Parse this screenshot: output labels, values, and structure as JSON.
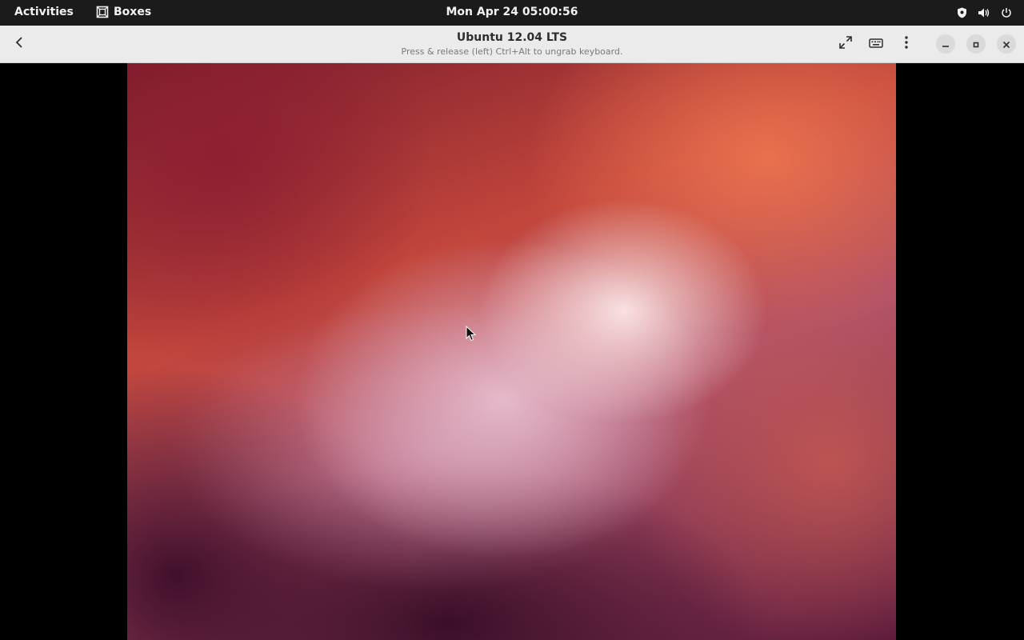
{
  "topbar": {
    "activities_label": "Activities",
    "app_name": "Boxes",
    "clock": "Mon Apr 24  05:00:56",
    "system_icons": [
      "shield-icon",
      "volume-icon",
      "power-icon"
    ]
  },
  "headerbar": {
    "title": "Ubuntu 12.04 LTS",
    "subtitle": "Press & release (left) Ctrl+Alt to ungrab keyboard.",
    "buttons": [
      "back-icon",
      "fullscreen-icon",
      "keyboard-icon",
      "menu-icon",
      "minimize-icon",
      "maximize-icon",
      "close-icon"
    ]
  },
  "colors": {
    "topbar_bg": "#1b1b1b",
    "headerbar_bg": "#ebebeb",
    "wallpaper_primary": "#c2463c",
    "wallpaper_dark": "#5a1a3c"
  }
}
